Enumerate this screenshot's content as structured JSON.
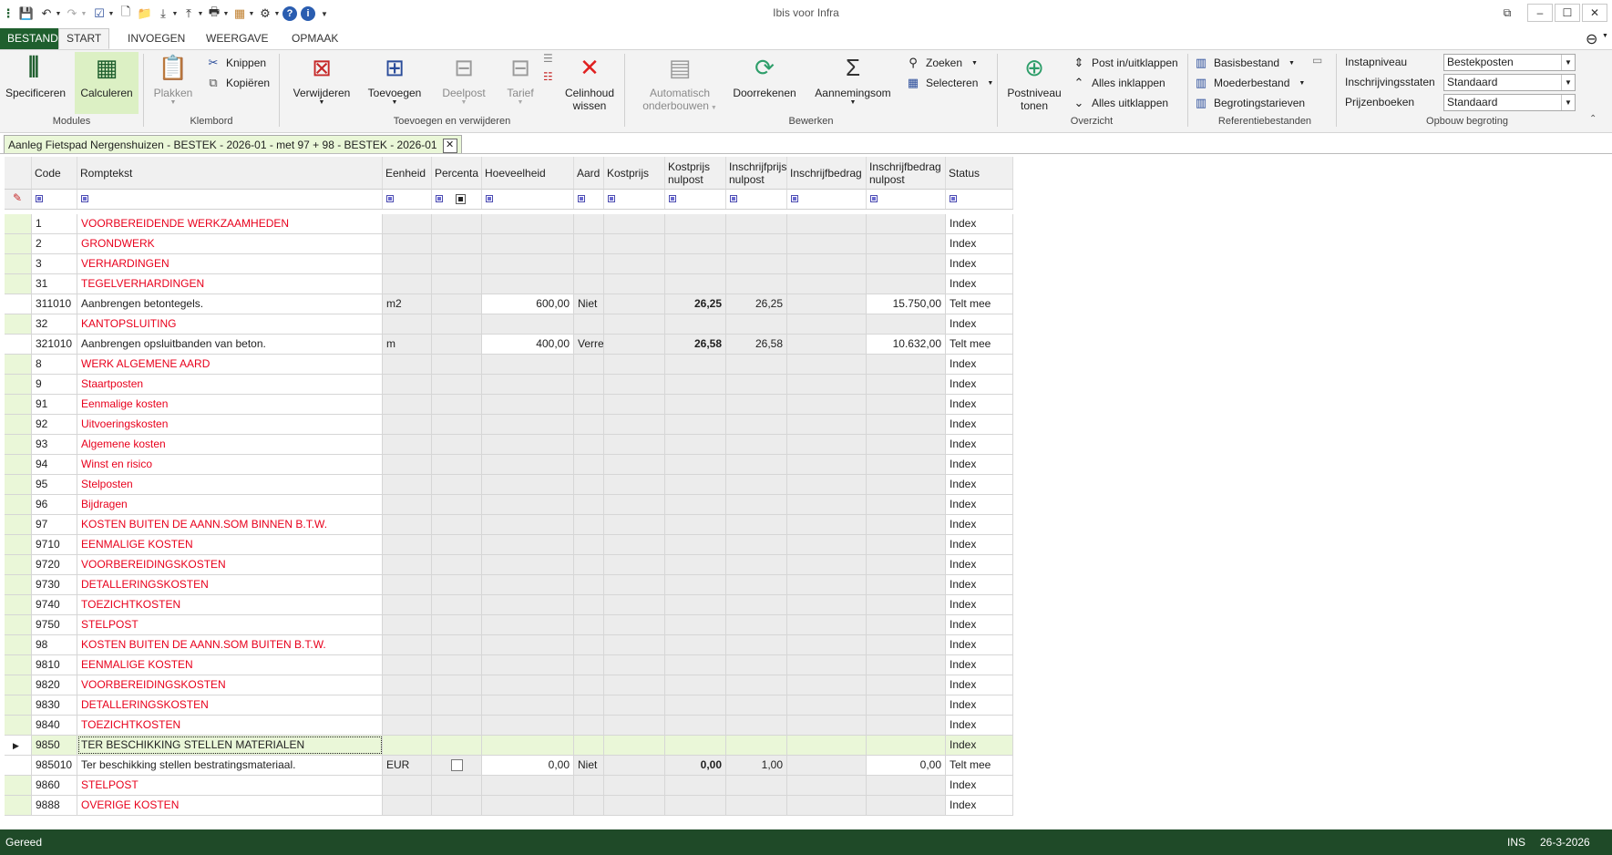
{
  "window": {
    "title": "Ibis voor Infra",
    "minimize": "–",
    "maximize": "☐",
    "close": "✕",
    "restore_icon": "⧉"
  },
  "menu": {
    "file": "BESTAND",
    "tabs": [
      "START",
      "INVOEGEN",
      "WEERGAVE",
      "OPMAAK"
    ],
    "active": "START",
    "account_icon": "person-circle-icon"
  },
  "ribbon": {
    "modules": {
      "label": "Modules",
      "specificeren": "Specificeren",
      "calculeren": "Calculeren"
    },
    "klembord": {
      "label": "Klembord",
      "plakken": "Plakken",
      "knippen": "Knippen",
      "kopieren": "Kopiëren"
    },
    "toevoegen": {
      "label": "Toevoegen en verwijderen",
      "verwijderen": "Verwijderen",
      "toevoegen": "Toevoegen",
      "deelpost": "Deelpost",
      "tarief": "Tarief",
      "celinhoud_1": "Celinhoud",
      "celinhoud_2": "wissen"
    },
    "bewerken": {
      "label": "Bewerken",
      "auto_1": "Automatisch",
      "auto_2": "onderbouwen",
      "doorrekenen": "Doorrekenen",
      "aannemingsom": "Aannemingsom",
      "zoeken": "Zoeken",
      "selecteren": "Selecteren"
    },
    "overzicht": {
      "label": "Overzicht",
      "postniveau_1": "Postniveau",
      "postniveau_2": "tonen",
      "post_inuit": "Post in/uitklappen",
      "alles_in": "Alles inklappen",
      "alles_uit": "Alles uitklappen"
    },
    "referentie": {
      "label": "Referentiebestanden",
      "basisbestand": "Basisbestand",
      "moederbestand": "Moederbestand",
      "begrotingstarieven": "Begrotingstarieven"
    },
    "opbouw": {
      "label": "Opbouw begroting",
      "instapniveau_label": "Instapniveau",
      "instapniveau_value": "Bestekposten",
      "inschrijvingsstaten_label": "Inschrijvingsstaten",
      "inschrijvingsstaten_value": "Standaard",
      "prijzenboeken_label": "Prijzenboeken",
      "prijzenboeken_value": "Standaard"
    }
  },
  "document_tab": {
    "title": "Aanleg Fietspad Nergenshuizen - BESTEK - 2026-01 - met 97 + 98 - BESTEK - 2026-01",
    "close": "✕"
  },
  "grid": {
    "headers": {
      "code": "Code",
      "romptekst": "Romptekst",
      "eenheid": "Eenheid",
      "percentage": "Percenta",
      "hoeveelheid": "Hoeveelheid",
      "aard": "Aard",
      "kostprijs": "Kostprijs",
      "kostprijs_nulpost_1": "Kostprijs",
      "kostprijs_nulpost_2": "nulpost",
      "inschrijfprijs_nulpost_1": "Inschrijfprijs",
      "inschrijfprijs_nulpost_2": "nulpost",
      "inschrijfbedrag": "Inschrijfbedrag",
      "inschrijfbedrag_nulpost_1": "Inschrijfbedrag",
      "inschrijfbedrag_nulpost_2": "nulpost",
      "status": "Status"
    },
    "rows": [
      {
        "code": "1",
        "text": "VOORBEREIDENDE WERKZAAMHEDEN",
        "status": "Index",
        "type": "chapter"
      },
      {
        "code": "2",
        "text": "GRONDWERK",
        "status": "Index",
        "type": "chapter"
      },
      {
        "code": "3",
        "text": "VERHARDINGEN",
        "status": "Index",
        "type": "chapter"
      },
      {
        "code": "31",
        "text": "TEGELVERHARDINGEN",
        "status": "Index",
        "type": "chapter"
      },
      {
        "code": "311010",
        "text": "Aanbrengen betontegels.",
        "eenheid": "m2",
        "hoeveelheid": "600,00",
        "aard": "Niet",
        "kostprijs_nulpost": "26,25",
        "inschrijfprijs_nulpost": "26,25",
        "inschrijfbedrag_nulpost": "15.750,00",
        "status": "Telt mee",
        "type": "post"
      },
      {
        "code": "32",
        "text": "KANTOPSLUITING",
        "status": "Index",
        "type": "chapter"
      },
      {
        "code": "321010",
        "text": "Aanbrengen opsluitbanden van beton.",
        "eenheid": "m",
        "hoeveelheid": "400,00",
        "aard": "Verre",
        "kostprijs_nulpost": "26,58",
        "inschrijfprijs_nulpost": "26,58",
        "inschrijfbedrag_nulpost": "10.632,00",
        "status": "Telt mee",
        "type": "post"
      },
      {
        "code": "8",
        "text": "WERK ALGEMENE AARD",
        "status": "Index",
        "type": "chapter"
      },
      {
        "code": "9",
        "text": "Staartposten",
        "status": "Index",
        "type": "chapter"
      },
      {
        "code": "91",
        "text": "Eenmalige kosten",
        "status": "Index",
        "type": "chapter"
      },
      {
        "code": "92",
        "text": "Uitvoeringskosten",
        "status": "Index",
        "type": "chapter"
      },
      {
        "code": "93",
        "text": "Algemene kosten",
        "status": "Index",
        "type": "chapter"
      },
      {
        "code": "94",
        "text": "Winst en risico",
        "status": "Index",
        "type": "chapter"
      },
      {
        "code": "95",
        "text": "Stelposten",
        "status": "Index",
        "type": "chapter"
      },
      {
        "code": "96",
        "text": "Bijdragen",
        "status": "Index",
        "type": "chapter"
      },
      {
        "code": "97",
        "text": "KOSTEN BUITEN DE AANN.SOM BINNEN B.T.W.",
        "status": "Index",
        "type": "chapter"
      },
      {
        "code": "9710",
        "text": "EENMALIGE KOSTEN",
        "status": "Index",
        "type": "chapter"
      },
      {
        "code": "9720",
        "text": "VOORBEREIDINGSKOSTEN",
        "status": "Index",
        "type": "chapter"
      },
      {
        "code": "9730",
        "text": "DETALLERINGSKOSTEN",
        "status": "Index",
        "type": "chapter"
      },
      {
        "code": "9740",
        "text": "TOEZICHTKOSTEN",
        "status": "Index",
        "type": "chapter"
      },
      {
        "code": "9750",
        "text": "STELPOST",
        "status": "Index",
        "type": "chapter"
      },
      {
        "code": "98",
        "text": "KOSTEN BUITEN DE AANN.SOM BUITEN B.T.W.",
        "status": "Index",
        "type": "chapter"
      },
      {
        "code": "9810",
        "text": "EENMALIGE KOSTEN",
        "status": "Index",
        "type": "chapter"
      },
      {
        "code": "9820",
        "text": "VOORBEREIDINGSKOSTEN",
        "status": "Index",
        "type": "chapter"
      },
      {
        "code": "9830",
        "text": "DETALLERINGSKOSTEN",
        "status": "Index",
        "type": "chapter"
      },
      {
        "code": "9840",
        "text": "TOEZICHTKOSTEN",
        "status": "Index",
        "type": "chapter"
      },
      {
        "code": "9850",
        "text": "TER BESCHIKKING STELLEN MATERIALEN",
        "status": "Index",
        "type": "selected"
      },
      {
        "code": "985010",
        "text": "Ter beschikking stellen bestratingsmateriaal.",
        "eenheid": "EUR",
        "checkbox": true,
        "hoeveelheid": "0,00",
        "aard": "Niet",
        "kostprijs_nulpost": "0,00",
        "inschrijfprijs_nulpost": "1,00",
        "inschrijfbedrag_nulpost": "0,00",
        "status": "Telt mee",
        "type": "post"
      },
      {
        "code": "9860",
        "text": "STELPOST",
        "status": "Index",
        "type": "chapter"
      },
      {
        "code": "9888",
        "text": "OVERIGE KOSTEN",
        "status": "Index",
        "type": "chapter"
      }
    ]
  },
  "statusbar": {
    "left": "Gereed",
    "mode": "INS",
    "date": "26-3-2026"
  },
  "colors": {
    "brand_green": "#1f5f2e",
    "row_green": "#eaf7d8",
    "chapter_red": "#e8001c"
  }
}
